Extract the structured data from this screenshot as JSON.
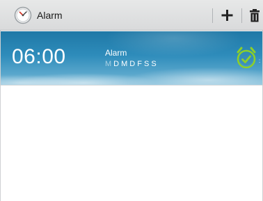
{
  "app": {
    "title": "Alarm",
    "icon": "alarm-clock-icon"
  },
  "toolbar": {
    "add_icon": "plus-icon",
    "delete_icon": "trash-icon"
  },
  "alarms": [
    {
      "time": "06:00",
      "name": "Alarm",
      "days": [
        {
          "label": "M",
          "active": false
        },
        {
          "label": "D",
          "active": true
        },
        {
          "label": "M",
          "active": true
        },
        {
          "label": "D",
          "active": true
        },
        {
          "label": "F",
          "active": true
        },
        {
          "label": "S",
          "active": true
        },
        {
          "label": "S",
          "active": true
        }
      ],
      "enabled": true,
      "toggle_icon": "alarm-clock-check-icon"
    }
  ],
  "colors": {
    "action_bar": "#dedfe0",
    "card_sky": "#2e8cbb",
    "toggle_green": "#8ccf2a"
  }
}
